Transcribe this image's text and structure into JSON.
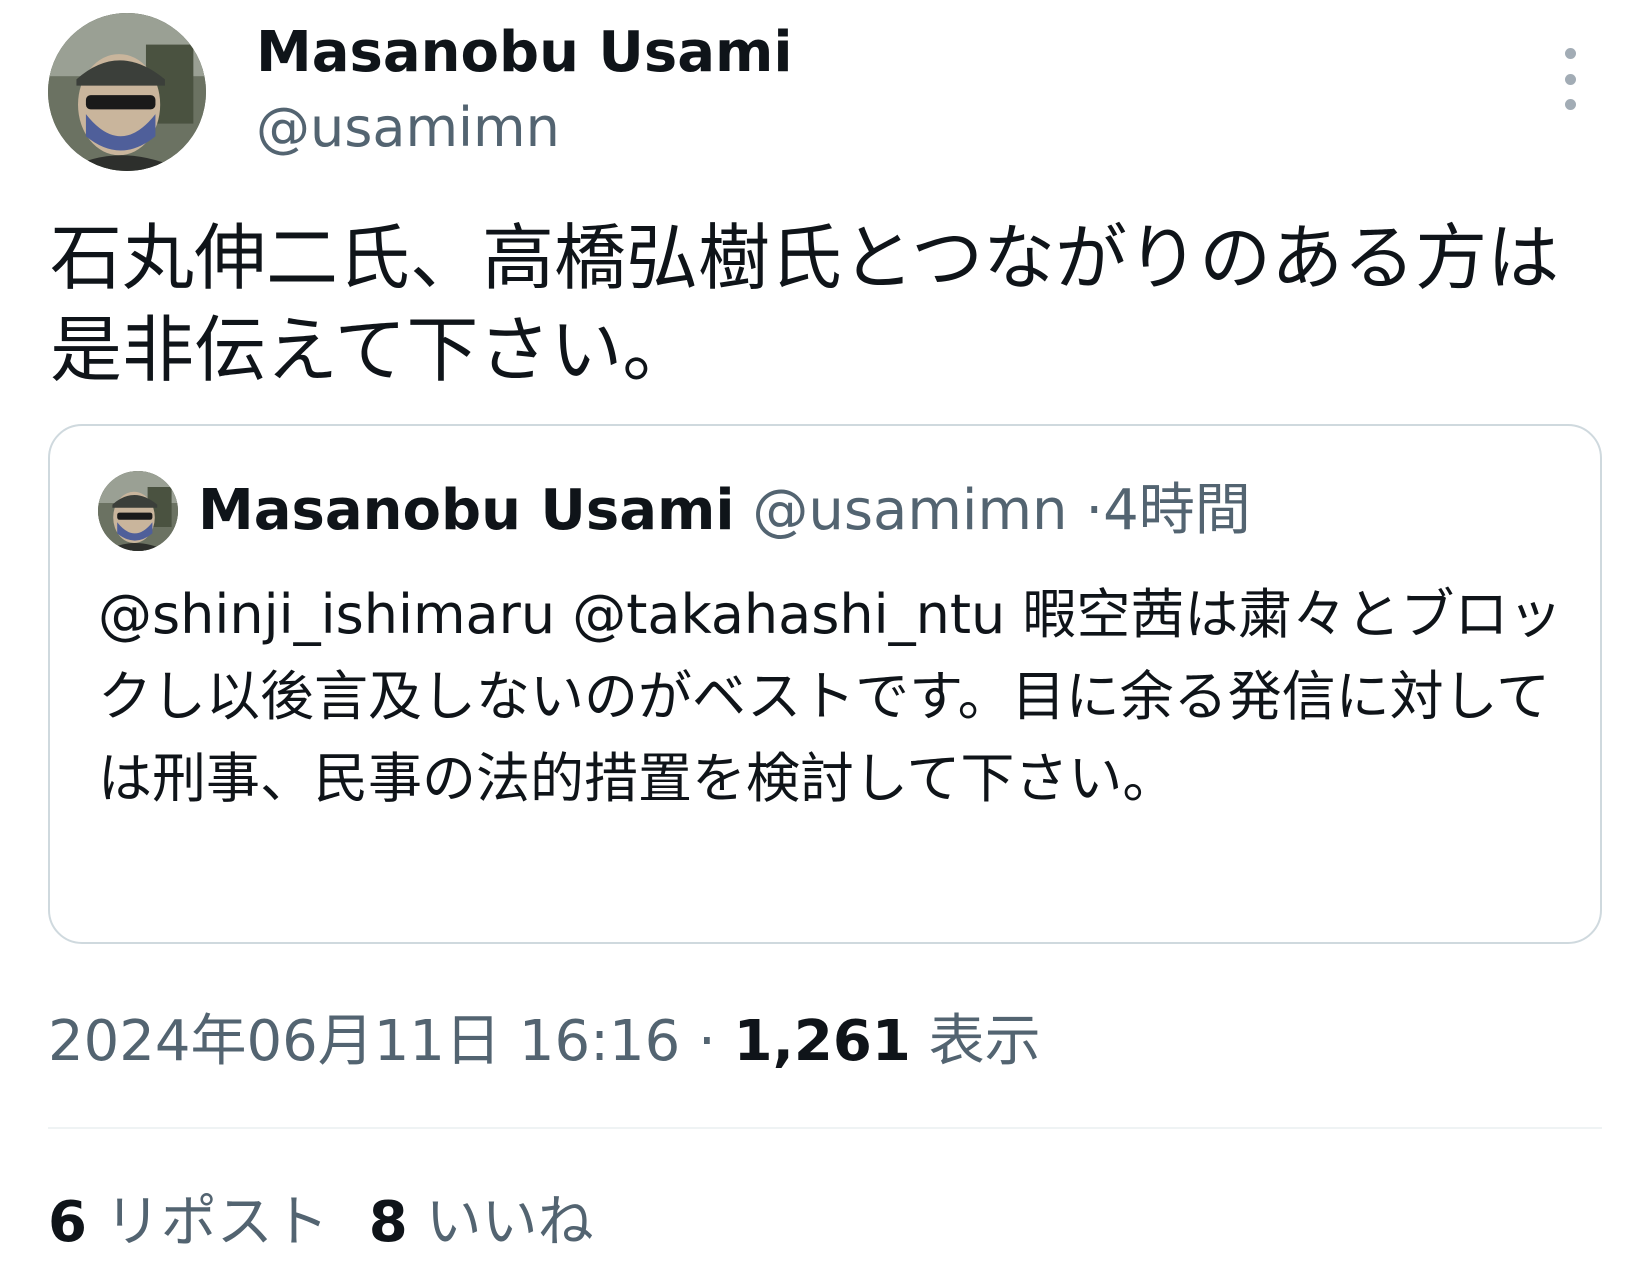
{
  "tweet": {
    "author": {
      "name": "Masanobu Usami",
      "handle": "@usamimn"
    },
    "text": "石丸伸二氏、高橋弘樹氏とつながりのある方は是非伝えて下さい。",
    "quoted": {
      "author": {
        "name": "Masanobu Usami",
        "handle": "@usamimn"
      },
      "separator": "·",
      "time": "4時間",
      "text": "@shinji_ishimaru @takahashi_ntu 暇空茜は粛々とブロックし以後言及しないのがベストです。目に余る発信に対しては刑事、民事の法的措置を検討して下さい。"
    },
    "meta": {
      "datetime": "2024年06月11日 16:16",
      "separator": "·",
      "views_count": "1,261",
      "views_label": "表示"
    },
    "stats": {
      "reposts_count": "6",
      "reposts_label": "リポスト",
      "likes_count": "8",
      "likes_label": "いいね"
    }
  },
  "icons": {
    "more": "more-vertical-icon",
    "avatar": "avatar-photo"
  },
  "colors": {
    "primary_text": "#0f1419",
    "secondary_text": "#536471",
    "border": "#cfd9de"
  }
}
